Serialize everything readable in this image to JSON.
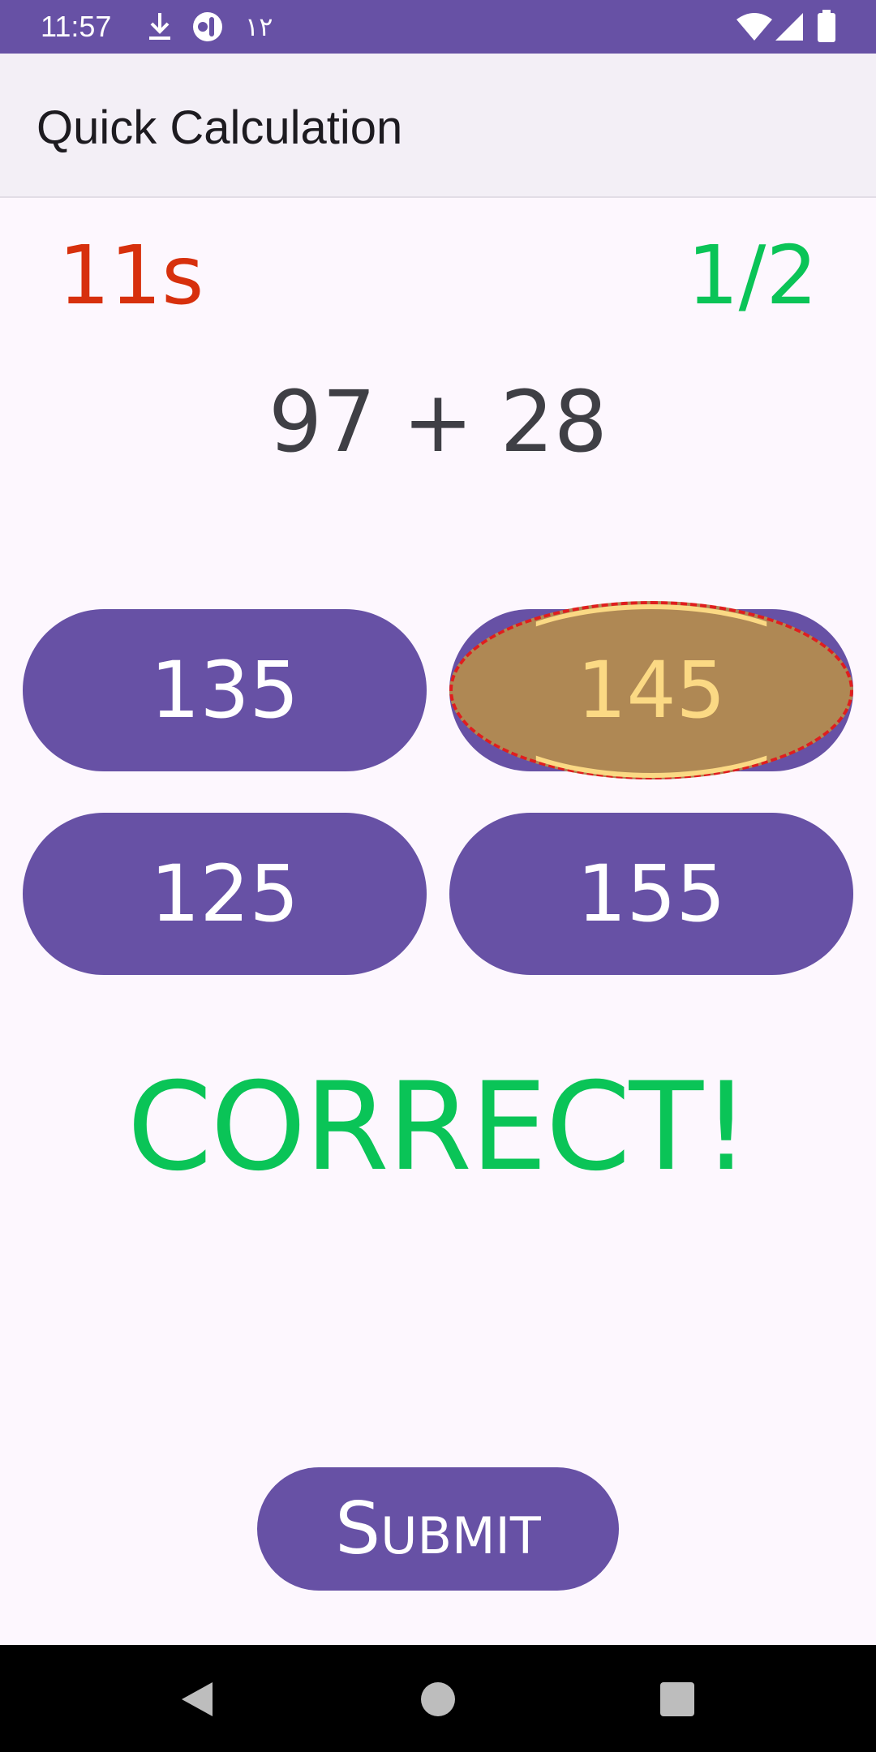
{
  "status_bar": {
    "time": "11:57",
    "arabic_text": "١٢",
    "icons": [
      "download-icon",
      "notification-app-icon",
      "wifi-icon",
      "signal-icon",
      "battery-icon"
    ]
  },
  "app_bar": {
    "title": "Quick Calculation"
  },
  "game": {
    "timer": "11s",
    "progress": "1/2",
    "question": "97 + 28",
    "options": [
      "135",
      "145",
      "125",
      "155"
    ],
    "selected_option": "145",
    "feedback": "CORRECT!",
    "submit_label": "Submit"
  },
  "colors": {
    "primary": "#6751a5",
    "timer": "#d7300d",
    "correct": "#0ac457",
    "selected_fill": "#af8854",
    "selected_text": "#fbd984"
  },
  "nav_bar": {
    "icons": [
      "back-icon",
      "home-icon",
      "recents-icon"
    ]
  }
}
